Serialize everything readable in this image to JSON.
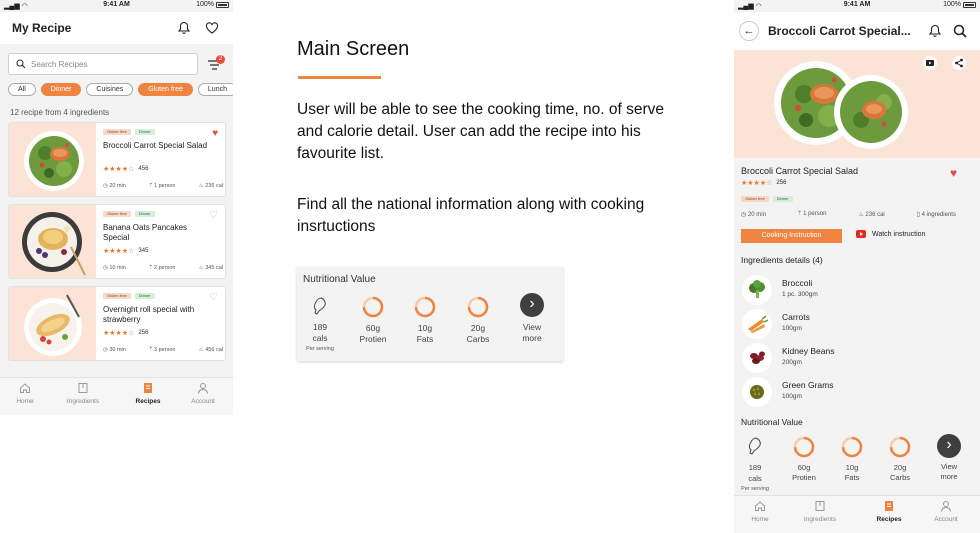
{
  "status_bar": {
    "time": "9:41 AM",
    "battery": "100%"
  },
  "left_phone": {
    "title": "My Recipe",
    "search_placeholder": "Search Recipes",
    "filter_badge": "2",
    "chips": [
      "All",
      "Dinner",
      "Cuisines",
      "Gluten free",
      "Lunch"
    ],
    "active_chips": [
      "Dinner",
      "Gluten free"
    ],
    "count_text": "12 recipe from 4 ingredients",
    "cards": [
      {
        "tags": [
          "Gluten free",
          "Dinner"
        ],
        "name": "Broccoli Carrot Special Salad",
        "rating": "456",
        "stars": 3.5,
        "time": "20 min",
        "serves": "1 person",
        "cal": "236 cal",
        "favourite": true
      },
      {
        "tags": [
          "Gluten free",
          "Dinner"
        ],
        "name": "Banana Oats Pancakes Special",
        "rating": "345",
        "stars": 3.5,
        "time": "10 min",
        "serves": "2 person",
        "cal": "345 cal",
        "favourite": false
      },
      {
        "tags": [
          "Gluten free",
          "Dinner"
        ],
        "name": "Overnight roll special with strawberry",
        "rating": "256",
        "stars": 3.5,
        "time": "30 min",
        "serves": "3 person",
        "cal": "456 cal",
        "favourite": false
      }
    ]
  },
  "tabbar": {
    "tabs": [
      "Home",
      "Ingredients",
      "Recipes",
      "Account"
    ],
    "active": "Recipes"
  },
  "center": {
    "heading": "Main Screen",
    "paragraph_1": "User will be able to see the cooking time, no. of serve and calorie detail. User can add the recipe into his favourite list.",
    "paragraph_1_lines": [
      "User will be able to see the cooking time, no. of serve",
      "and calorie detail. User can add the recipe into his",
      "favourite list."
    ],
    "paragraph_2_lines": [
      "Find all the national information along with cooking",
      "insrtuctions"
    ]
  },
  "nutrition": {
    "title": "Nutritional Value",
    "cals_value": "189",
    "cals_label": "cals",
    "per_serving": "Per serving",
    "items": [
      {
        "value": "60g",
        "label": "Protien"
      },
      {
        "value": "10g",
        "label": "Fats"
      },
      {
        "value": "20g",
        "label": "Carbs"
      }
    ],
    "more_line1": "View",
    "more_line2": "more"
  },
  "right_phone": {
    "title": "Broccoli Carrot Special...",
    "recipe_name": "Broccoli Carrot Special Salad",
    "rating": "256",
    "stars": 3.5,
    "tags": [
      "Gluten free",
      "Dinner"
    ],
    "time": "20 min",
    "serves": "1 person",
    "cal": "236 cal",
    "ingredients_count": "4 ingredients",
    "cook_button": "Cooking Instruction",
    "watch_label": "Watch instruction",
    "ingredients_heading": "Ingredients details (4)",
    "ingredients": [
      {
        "name": "Broccoli",
        "qty": "1 pc. 300gm"
      },
      {
        "name": "Carrots",
        "qty": "100gm"
      },
      {
        "name": "Kidney Beans",
        "qty": "200gm"
      },
      {
        "name": "Green Grams",
        "qty": "100gm"
      }
    ],
    "nutrition_heading": "Nutritional Value"
  },
  "colors": {
    "accent": "#ef8440",
    "heart": "#e84c4c",
    "hero_bg": "#fbe3d6",
    "star": "#e07a2e"
  }
}
